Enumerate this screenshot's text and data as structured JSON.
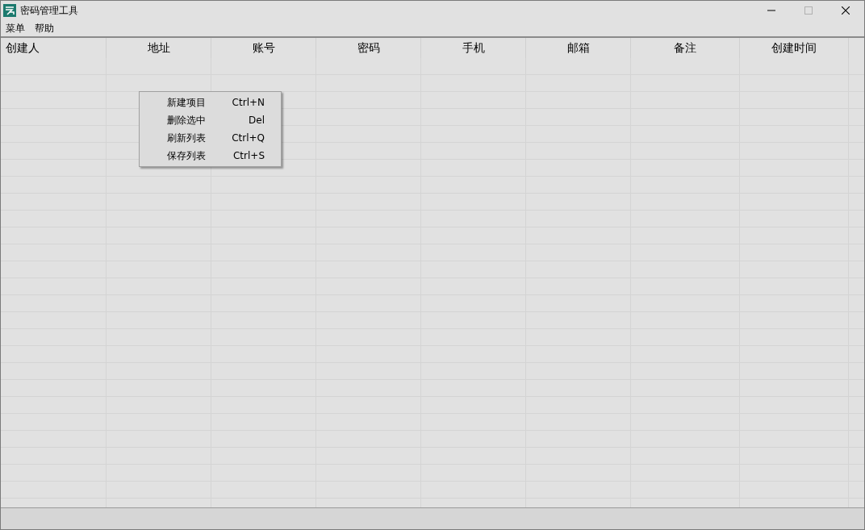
{
  "window": {
    "title": "密码管理工具",
    "controls": [
      {
        "kind": "minimize",
        "disabled": false
      },
      {
        "kind": "maximize",
        "disabled": true
      },
      {
        "kind": "close",
        "disabled": false
      }
    ]
  },
  "menu_bar": [
    "菜单",
    "帮助"
  ],
  "table": {
    "columns": [
      "创建人",
      "地址",
      "账号",
      "密码",
      "手机",
      "邮箱",
      "备注",
      "创建时间"
    ]
  },
  "context_menu": [
    {
      "label": "新建项目",
      "shortcut": "Ctrl+N"
    },
    {
      "label": "删除选中",
      "shortcut": "Del"
    },
    {
      "label": "刷新列表",
      "shortcut": "Ctrl+Q"
    },
    {
      "label": "保存列表",
      "shortcut": "Ctrl+S"
    }
  ]
}
